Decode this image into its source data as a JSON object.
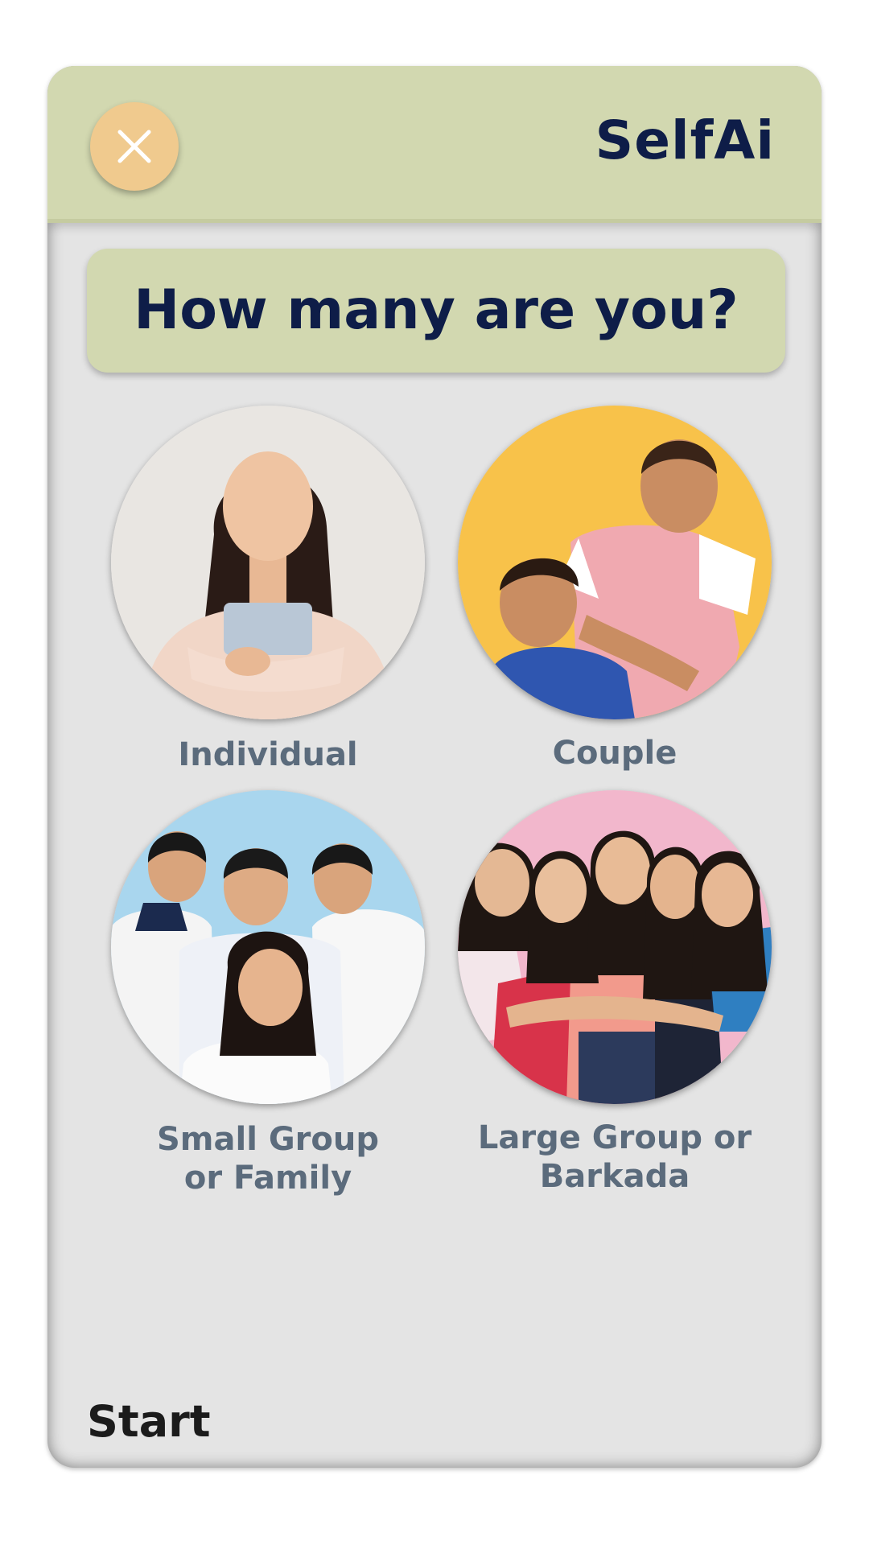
{
  "header": {
    "title": "SelfAi",
    "close_icon": "close-icon"
  },
  "question": "How many are you?",
  "options": [
    {
      "label": "Individual",
      "photo_background": "#e6e2df"
    },
    {
      "label": "Couple",
      "photo_background": "#f8c24a"
    },
    {
      "label": "Small Group or Family",
      "label_line1": "Small Group",
      "label_line2": "or Family",
      "photo_background": "#a9d6ee"
    },
    {
      "label": "Large Group or Barkada",
      "label_line1": "Large Group or",
      "label_line2": "Barkada",
      "photo_background": "#f2b7cc"
    }
  ],
  "footer": {
    "start_label": "Start"
  },
  "colors": {
    "header_bg": "#d2d8b0",
    "title_color": "#0e1d48",
    "close_button": "#f0ca8e",
    "card_bg": "#e4e4e4",
    "label_color": "#5b6b7c"
  }
}
